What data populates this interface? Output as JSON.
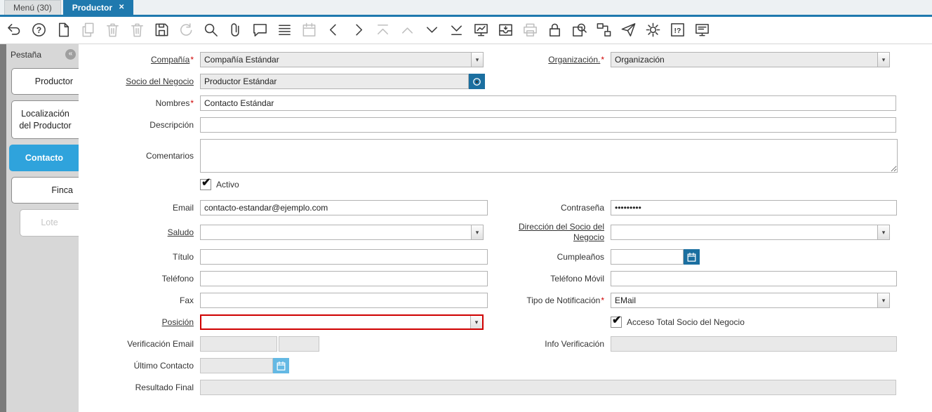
{
  "tabbar": {
    "tabs": [
      {
        "label": "Menú (30)",
        "active": false
      },
      {
        "label": "Productor",
        "active": true
      }
    ]
  },
  "toolbar": {
    "icons": [
      {
        "name": "undo-icon",
        "sym": "undo",
        "disabled": false
      },
      {
        "name": "help-icon",
        "sym": "help",
        "disabled": false
      },
      {
        "name": "new-record-icon",
        "sym": "doc",
        "disabled": false
      },
      {
        "name": "copy-record-icon",
        "sym": "copy",
        "disabled": true
      },
      {
        "name": "delete-record-icon",
        "sym": "trash",
        "disabled": true
      },
      {
        "name": "delete-selection-icon",
        "sym": "trash",
        "disabled": true
      },
      {
        "name": "save-icon",
        "sym": "save",
        "disabled": false
      },
      {
        "name": "refresh-icon",
        "sym": "refresh",
        "disabled": true
      },
      {
        "name": "find-icon",
        "sym": "search",
        "disabled": false
      },
      {
        "name": "attachment-icon",
        "sym": "clip",
        "disabled": false
      },
      {
        "name": "chat-icon",
        "sym": "chat",
        "disabled": false
      },
      {
        "name": "grid-toggle-icon",
        "sym": "lines",
        "disabled": false
      },
      {
        "name": "calendar-icon",
        "sym": "calendar",
        "disabled": true
      },
      {
        "name": "previous-record-icon",
        "sym": "chevl",
        "disabled": false
      },
      {
        "name": "next-record-icon",
        "sym": "chevr",
        "disabled": false
      },
      {
        "name": "first-record-icon",
        "sym": "chevupbar",
        "disabled": true
      },
      {
        "name": "parent-record-icon",
        "sym": "chevup",
        "disabled": true
      },
      {
        "name": "detail-record-icon",
        "sym": "chevdown",
        "disabled": false
      },
      {
        "name": "last-record-icon",
        "sym": "chevdownbar",
        "disabled": false
      },
      {
        "name": "report-icon",
        "sym": "board",
        "disabled": false
      },
      {
        "name": "archive-icon",
        "sym": "archive",
        "disabled": false
      },
      {
        "name": "print-icon",
        "sym": "printer",
        "disabled": true
      },
      {
        "name": "private-record-lock-icon",
        "sym": "lock",
        "disabled": false
      },
      {
        "name": "zoom-across-icon",
        "sym": "zoombox",
        "disabled": false
      },
      {
        "name": "workflow-icon",
        "sym": "workflow",
        "disabled": false
      },
      {
        "name": "requests-icon",
        "sym": "plane",
        "disabled": false
      },
      {
        "name": "preferences-icon",
        "sym": "gear",
        "disabled": false
      },
      {
        "name": "product-info-icon",
        "sym": "boxinfo",
        "disabled": false
      },
      {
        "name": "support-window-icon",
        "sym": "monitor",
        "disabled": false
      }
    ]
  },
  "sidebar": {
    "header": "Pestaña",
    "tabs": [
      {
        "label": "Productor",
        "state": "normal"
      },
      {
        "label": "Localización del Productor",
        "state": "normal"
      },
      {
        "label": "Contacto",
        "state": "active"
      },
      {
        "label": "Finca",
        "state": "normal"
      },
      {
        "label": "Lote",
        "state": "disabled"
      }
    ]
  },
  "form": {
    "compania": {
      "label": "Compañía",
      "value": "Compañía Estándar"
    },
    "organizacion": {
      "label": "Organización.",
      "value": "Organización"
    },
    "socio": {
      "label": "Socio del Negocio",
      "value": "Productor Estándar"
    },
    "nombres": {
      "label": "Nombres",
      "value": "Contacto Estándar"
    },
    "descripcion": {
      "label": "Descripción",
      "value": ""
    },
    "comentarios": {
      "label": "Comentarios",
      "value": ""
    },
    "activo": {
      "label": "Activo"
    },
    "email": {
      "label": "Email",
      "value": "contacto-estandar@ejemplo.com"
    },
    "contrasena": {
      "label": "Contraseña",
      "value": "•••••••••"
    },
    "saludo": {
      "label": "Saludo",
      "value": ""
    },
    "direccion": {
      "label": "Dirección del Socio del Negocio",
      "value": ""
    },
    "titulo": {
      "label": "Título",
      "value": ""
    },
    "cumpleanos": {
      "label": "Cumpleaños",
      "value": ""
    },
    "telefono": {
      "label": "Teléfono",
      "value": ""
    },
    "movil": {
      "label": "Teléfono Móvil",
      "value": ""
    },
    "fax": {
      "label": "Fax",
      "value": ""
    },
    "notificacion": {
      "label": "Tipo de Notificación",
      "value": "EMail"
    },
    "posicion": {
      "label": "Posición",
      "value": ""
    },
    "acceso": {
      "label": "Acceso Total Socio del Negocio"
    },
    "verificacion": {
      "label": "Verificación Email",
      "value1": "",
      "value2": ""
    },
    "info_verificacion": {
      "label": "Info Verificación",
      "value": ""
    },
    "ultimo_contacto": {
      "label": "Último Contacto",
      "value": ""
    },
    "resultado": {
      "label": "Resultado Final",
      "value": ""
    }
  }
}
